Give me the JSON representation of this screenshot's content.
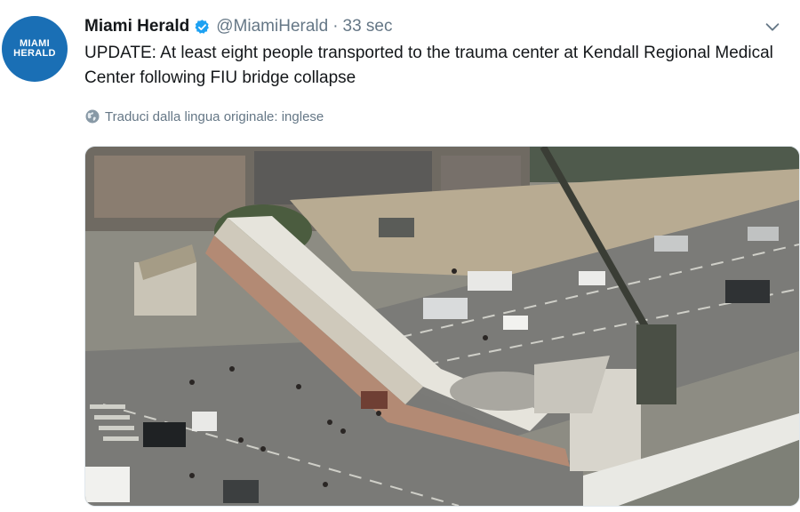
{
  "tweet": {
    "avatar": {
      "logo_line1": "MIAMI",
      "logo_line2": "HERALD",
      "brand_color": "#1a6fb5"
    },
    "author_name": "Miami Herald",
    "verified_icon": "verified-badge-icon",
    "handle": "@MiamiHerald",
    "separator": "·",
    "timestamp": "33 sec",
    "text": "UPDATE: At least eight people transported to the trauma center at Kendall Regional Medical Center following FIU bridge collapse",
    "translate_label": "Traduci dalla lingua originale: inglese",
    "translate_icon": "globe-icon",
    "menu_icon": "chevron-down-icon",
    "media": {
      "type": "photo"
    }
  },
  "colors": {
    "text": "#14171a",
    "secondary": "#657786",
    "accent": "#1da1f2"
  }
}
